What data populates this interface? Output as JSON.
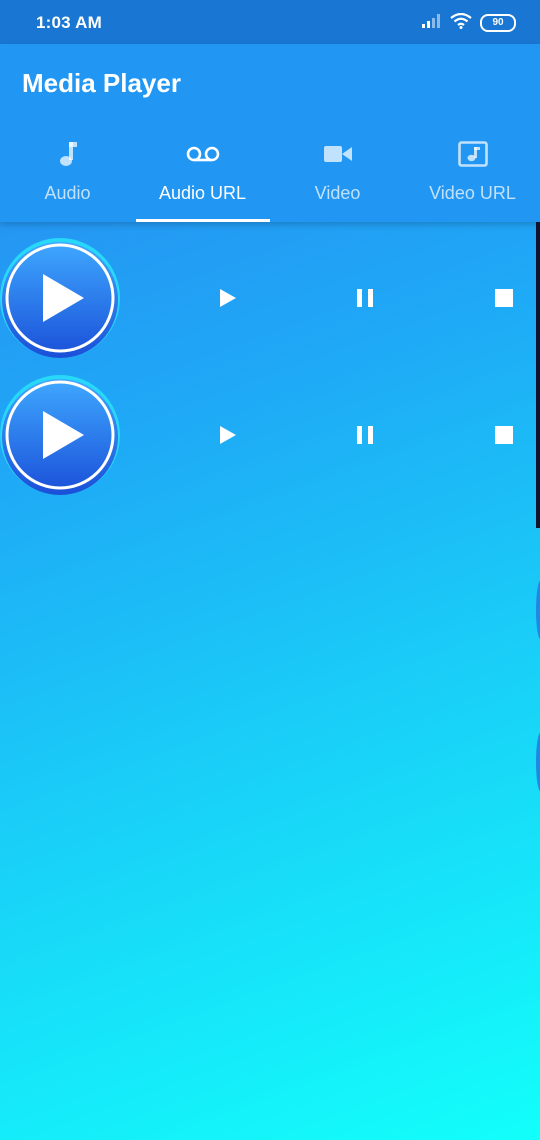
{
  "status_bar": {
    "time": "1:03 AM",
    "battery": "90",
    "icons": [
      "signal-icon",
      "wifi-icon",
      "battery-icon"
    ]
  },
  "app_bar": {
    "title": "Media Player"
  },
  "tabs": [
    {
      "label": "Audio",
      "icon": "music-note-icon",
      "active": false
    },
    {
      "label": "Audio URL",
      "icon": "voicemail-icon",
      "active": true
    },
    {
      "label": "Video",
      "icon": "video-camera-icon",
      "active": false
    },
    {
      "label": "Video URL",
      "icon": "music-video-icon",
      "active": false
    }
  ],
  "players": [
    {
      "controls": [
        "play-icon",
        "pause-icon",
        "stop-icon"
      ]
    },
    {
      "controls": [
        "play-icon",
        "pause-icon",
        "stop-icon"
      ]
    }
  ],
  "colors": {
    "status_bar": "#1976d2",
    "app_bar": "#2196f3",
    "gradient_top": "#2a86f0",
    "gradient_bottom": "#12fffb",
    "play_button": "#1e6ff0"
  }
}
